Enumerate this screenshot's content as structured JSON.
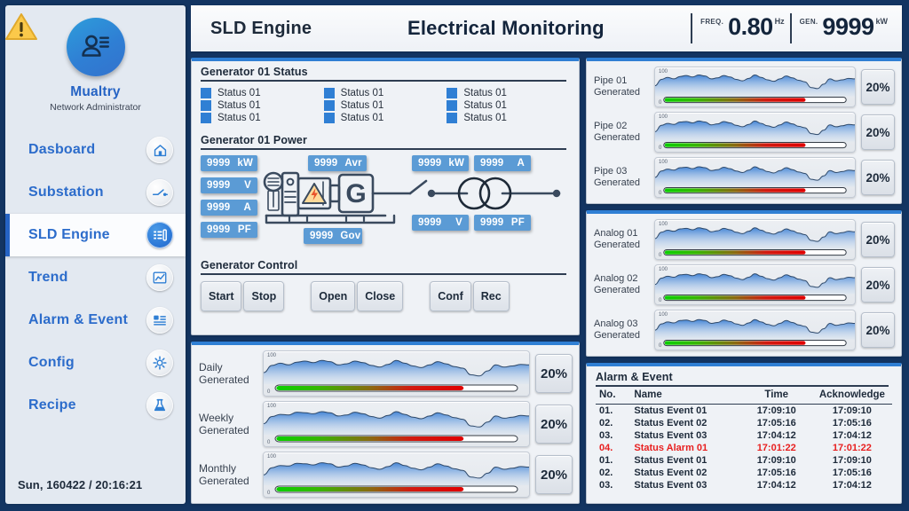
{
  "colors": {
    "accent": "#2f7fd4",
    "frame": "#133562",
    "sidebar_bg": "#e3e9f1",
    "chip_blue": "#5b9bd5",
    "alarm_red": "#e81f1f",
    "panel_bg": "#eff2f6"
  },
  "sidebar": {
    "warning_icon": "warning-triangle-icon",
    "avatar_icon": "user-profile-icon",
    "user_name": "Mualtry",
    "user_role": "Network Administrator",
    "items": [
      {
        "label": "Dasboard",
        "icon": "home-icon",
        "active": false
      },
      {
        "label": "Substation",
        "icon": "switch-icon",
        "active": false
      },
      {
        "label": "SLD Engine",
        "icon": "sld-engine-icon",
        "active": true
      },
      {
        "label": "Trend",
        "icon": "chart-line-icon",
        "active": false
      },
      {
        "label": "Alarm & Event",
        "icon": "list-alert-icon",
        "active": false
      },
      {
        "label": "Config",
        "icon": "gear-icon",
        "active": false
      },
      {
        "label": "Recipe",
        "icon": "flask-icon",
        "active": false
      }
    ],
    "clock": "Sun, 160422 / 20:16:21"
  },
  "header": {
    "page": "SLD Engine",
    "title": "Electrical Monitoring",
    "meters": [
      {
        "label": "FREQ.",
        "value": "0.80",
        "unit": "Hz"
      },
      {
        "label": "GEN.",
        "value": "9999",
        "unit": "kW"
      }
    ]
  },
  "generator_status": {
    "title": "Generator 01 Status",
    "items": [
      "Status 01",
      "Status 01",
      "Status 01",
      "Status 01",
      "Status 01",
      "Status 01",
      "Status 01",
      "Status 01",
      "Status 01"
    ]
  },
  "generator_power": {
    "title": "Generator 01 Power",
    "left_chips": [
      {
        "value": "9999",
        "unit": "kW"
      },
      {
        "value": "9999",
        "unit": "V"
      },
      {
        "value": "9999",
        "unit": "A"
      },
      {
        "value": "9999",
        "unit": "PF"
      }
    ],
    "top_chip": {
      "value": "9999",
      "unit": "Avr"
    },
    "bottom_chip": {
      "value": "9999",
      "unit": "Gov"
    },
    "right_top_chips": [
      {
        "value": "9999",
        "unit": "kW"
      },
      {
        "value": "9999",
        "unit": "A"
      }
    ],
    "right_bottom_chips": [
      {
        "value": "9999",
        "unit": "V"
      },
      {
        "value": "9999",
        "unit": "PF"
      }
    ],
    "diagram_icons": [
      "generator-unit-icon",
      "hazard-icon",
      "generator-g-icon",
      "breaker-icon",
      "transformer-icon"
    ]
  },
  "generator_control": {
    "title": "Generator Control",
    "buttons": [
      "Start",
      "Stop",
      "Open",
      "Close",
      "Conf",
      "Rec"
    ]
  },
  "bottom_gauges": {
    "rows": [
      {
        "name": "Daily",
        "sub": "Generated",
        "pct": "20%",
        "axis_top": "100",
        "axis_bottom": "0",
        "bar_fill": 78
      },
      {
        "name": "Weekly",
        "sub": "Generated",
        "pct": "20%",
        "axis_top": "100",
        "axis_bottom": "0",
        "bar_fill": 78
      },
      {
        "name": "Monthly",
        "sub": "Generated",
        "pct": "20%",
        "axis_top": "100",
        "axis_bottom": "0",
        "bar_fill": 78
      }
    ]
  },
  "pipe_gauges": {
    "rows": [
      {
        "name": "Pipe 01",
        "sub": "Generated",
        "pct": "20%",
        "axis_top": "100",
        "axis_bottom": "0",
        "bar_fill": 78
      },
      {
        "name": "Pipe 02",
        "sub": "Generated",
        "pct": "20%",
        "axis_top": "100",
        "axis_bottom": "0",
        "bar_fill": 78
      },
      {
        "name": "Pipe 03",
        "sub": "Generated",
        "pct": "20%",
        "axis_top": "100",
        "axis_bottom": "0",
        "bar_fill": 78
      }
    ]
  },
  "analog_gauges": {
    "rows": [
      {
        "name": "Analog 01",
        "sub": "Generated",
        "pct": "20%",
        "axis_top": "100",
        "axis_bottom": "0",
        "bar_fill": 78
      },
      {
        "name": "Analog 02",
        "sub": "Generated",
        "pct": "20%",
        "axis_top": "100",
        "axis_bottom": "0",
        "bar_fill": 78
      },
      {
        "name": "Analog 03",
        "sub": "Generated",
        "pct": "20%",
        "axis_top": "100",
        "axis_bottom": "0",
        "bar_fill": 78
      }
    ]
  },
  "alarm_event": {
    "title": "Alarm & Event",
    "columns": [
      "No.",
      "Name",
      "Time",
      "Acknowledge"
    ],
    "rows": [
      {
        "no": "01.",
        "name": "Status Event 01",
        "time": "17:09:10",
        "ack": "17:09:10",
        "alarm": false
      },
      {
        "no": "02.",
        "name": "Status Event 02",
        "time": "17:05:16",
        "ack": "17:05:16",
        "alarm": false
      },
      {
        "no": "03.",
        "name": "Status Event 03",
        "time": "17:04:12",
        "ack": "17:04:12",
        "alarm": false
      },
      {
        "no": "04.",
        "name": "Status Alarm 01",
        "time": "17:01:22",
        "ack": "17:01:22",
        "alarm": true
      },
      {
        "no": "01.",
        "name": "Status Event 01",
        "time": "17:09:10",
        "ack": "17:09:10",
        "alarm": false
      },
      {
        "no": "02.",
        "name": "Status Event 02",
        "time": "17:05:16",
        "ack": "17:05:16",
        "alarm": false
      },
      {
        "no": "03.",
        "name": "Status Event 03",
        "time": "17:04:12",
        "ack": "17:04:12",
        "alarm": false
      }
    ]
  },
  "chart_data": {
    "type": "area",
    "title": "Generated trend sparklines",
    "ylabel": "",
    "ylim": [
      0,
      100
    ],
    "grid": false,
    "legend": "none",
    "x": [
      0,
      1,
      2,
      3,
      4,
      5,
      6,
      7,
      8,
      9,
      10,
      11,
      12,
      13,
      14,
      15,
      16,
      17,
      18,
      19,
      20,
      21,
      22,
      23,
      24,
      25,
      26,
      27,
      28,
      29,
      30,
      31,
      32
    ],
    "series": [
      {
        "name": "Daily Generated",
        "values": [
          42,
          68,
          76,
          70,
          80,
          84,
          78,
          86,
          82,
          70,
          74,
          84,
          78,
          68,
          62,
          72,
          86,
          76,
          66,
          60,
          70,
          82,
          74,
          64,
          58,
          34,
          30,
          48,
          70,
          62,
          66,
          72,
          70
        ]
      },
      {
        "name": "Weekly Generated",
        "values": [
          40,
          66,
          74,
          72,
          82,
          80,
          76,
          84,
          80,
          68,
          72,
          82,
          76,
          66,
          60,
          70,
          84,
          74,
          64,
          58,
          68,
          80,
          72,
          62,
          56,
          32,
          28,
          46,
          68,
          60,
          64,
          70,
          68
        ]
      },
      {
        "name": "Monthly Generated",
        "values": [
          38,
          64,
          72,
          70,
          80,
          78,
          74,
          82,
          78,
          66,
          70,
          80,
          74,
          64,
          58,
          68,
          82,
          72,
          62,
          56,
          66,
          78,
          70,
          60,
          54,
          30,
          26,
          44,
          66,
          58,
          62,
          68,
          66
        ]
      },
      {
        "name": "Pipe 01 Generated",
        "values": [
          44,
          70,
          78,
          72,
          82,
          86,
          80,
          88,
          84,
          72,
          76,
          86,
          80,
          70,
          64,
          74,
          88,
          78,
          68,
          62,
          72,
          84,
          76,
          66,
          60,
          36,
          32,
          50,
          72,
          64,
          68,
          74,
          72
        ]
      },
      {
        "name": "Pipe 02 Generated",
        "values": [
          41,
          67,
          75,
          71,
          81,
          83,
          77,
          85,
          81,
          69,
          73,
          83,
          77,
          67,
          61,
          71,
          85,
          75,
          65,
          59,
          69,
          81,
          73,
          63,
          57,
          33,
          29,
          47,
          69,
          61,
          65,
          71,
          69
        ]
      },
      {
        "name": "Pipe 03 Generated",
        "values": [
          39,
          65,
          73,
          69,
          79,
          81,
          75,
          83,
          79,
          67,
          71,
          81,
          75,
          65,
          59,
          69,
          83,
          73,
          63,
          57,
          67,
          79,
          71,
          61,
          55,
          31,
          27,
          45,
          67,
          59,
          63,
          69,
          67
        ]
      },
      {
        "name": "Analog 01 Generated",
        "values": [
          43,
          69,
          77,
          73,
          83,
          85,
          79,
          87,
          83,
          71,
          75,
          85,
          79,
          69,
          63,
          73,
          87,
          77,
          67,
          61,
          71,
          83,
          75,
          65,
          59,
          35,
          31,
          49,
          71,
          63,
          67,
          73,
          71
        ]
      },
      {
        "name": "Analog 02 Generated",
        "values": [
          40,
          66,
          74,
          70,
          80,
          82,
          76,
          84,
          80,
          68,
          72,
          82,
          76,
          66,
          60,
          70,
          84,
          74,
          64,
          58,
          68,
          80,
          72,
          62,
          56,
          32,
          28,
          46,
          68,
          60,
          64,
          70,
          68
        ]
      },
      {
        "name": "Analog 03 Generated",
        "values": [
          38,
          64,
          72,
          68,
          78,
          80,
          74,
          82,
          78,
          66,
          70,
          80,
          74,
          64,
          58,
          68,
          82,
          72,
          62,
          56,
          66,
          78,
          70,
          60,
          54,
          30,
          26,
          44,
          66,
          58,
          62,
          68,
          66
        ]
      }
    ]
  }
}
